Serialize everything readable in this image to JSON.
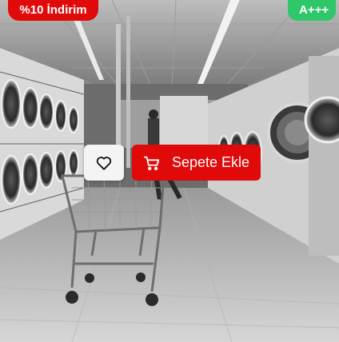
{
  "badges": {
    "discount": "%10 İndirim",
    "energy": "A+++"
  },
  "actions": {
    "favorite_icon": "heart-icon",
    "add_to_cart_icon": "cart-icon",
    "add_to_cart_label": "Sepete Ekle"
  },
  "colors": {
    "accent_red": "#e10a0a",
    "energy_green": "#2fc76a"
  }
}
